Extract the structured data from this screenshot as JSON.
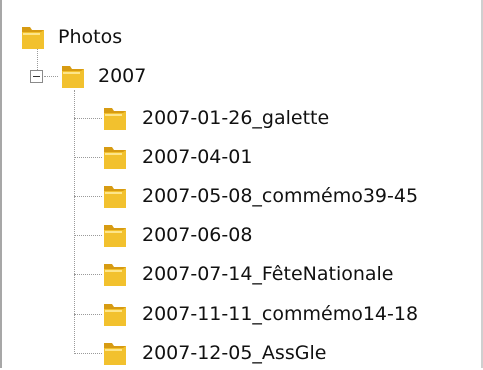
{
  "tree": {
    "root": {
      "label": "Photos",
      "icon": "folder-icon"
    },
    "year": {
      "label": "2007",
      "icon": "folder-icon",
      "expander": "minus"
    },
    "items": [
      {
        "label": "2007-01-26_galette"
      },
      {
        "label": "2007-04-01"
      },
      {
        "label": "2007-05-08_commémo39-45"
      },
      {
        "label": "2007-06-08"
      },
      {
        "label": "2007-07-14_FêteNationale"
      },
      {
        "label": "2007-11-11_commémo14-18"
      },
      {
        "label": "2007-12-05_AssGle"
      }
    ]
  },
  "colors": {
    "folder_body": "#f2c12e",
    "folder_dark": "#d79b12",
    "folder_light": "#fde58a",
    "tree_line": "#9a9a9a"
  }
}
